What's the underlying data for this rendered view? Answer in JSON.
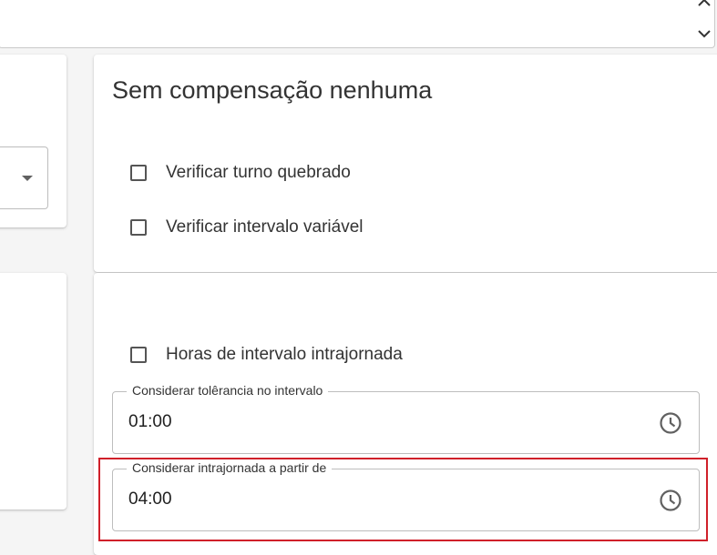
{
  "top_panel": {
    "collapse_icon": "chevron-up-icon",
    "expand_icon": "chevron-down-icon"
  },
  "compensation_card": {
    "title": "Sem compensação nenhuma",
    "checkboxes": [
      {
        "label": "Verificar turno quebrado",
        "checked": false
      },
      {
        "label": "Verificar intervalo variável",
        "checked": false
      }
    ]
  },
  "interval_card": {
    "checkbox": {
      "label": "Horas de intervalo intrajornada",
      "checked": false
    },
    "fields": [
      {
        "label": "Considerar tolêrancia no intervalo",
        "value": "01:00",
        "icon": "clock-icon"
      },
      {
        "label": "Considerar intrajornada a partir de",
        "value": "04:00",
        "icon": "clock-icon"
      }
    ]
  },
  "highlight_color": "#d0202a"
}
